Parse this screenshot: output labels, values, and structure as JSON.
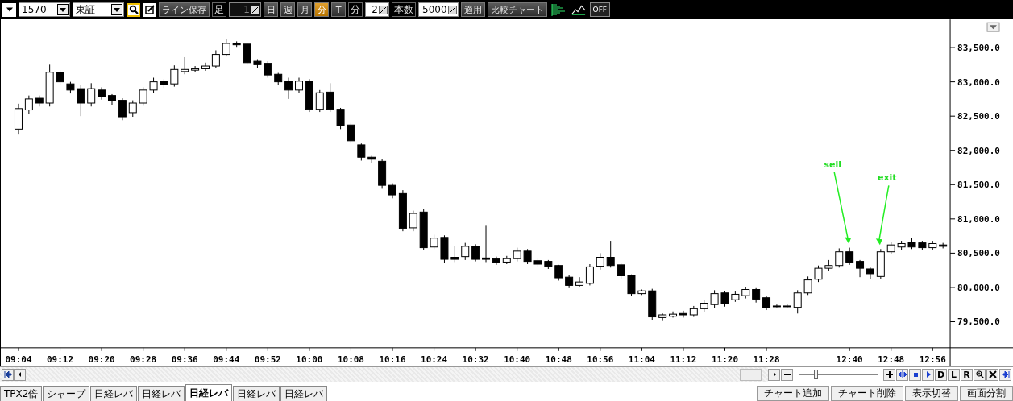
{
  "toolbar": {
    "items": [
      {
        "kind": "menu"
      },
      {
        "kind": "combo",
        "value": "1570"
      },
      {
        "kind": "combo",
        "value": "東証"
      },
      {
        "kind": "tool",
        "selected": true
      },
      {
        "kind": "tool",
        "selected": false
      },
      {
        "kind": "button",
        "label": "ライン保存"
      },
      {
        "kind": "label",
        "text": "足"
      },
      {
        "kind": "spin",
        "value": "1",
        "disabled": true
      },
      {
        "kind": "period",
        "label": "日",
        "selected": false
      },
      {
        "kind": "period",
        "label": "週",
        "selected": false
      },
      {
        "kind": "period",
        "label": "月",
        "selected": false
      },
      {
        "kind": "period",
        "label": "分",
        "selected": true
      },
      {
        "kind": "period",
        "label": "T",
        "selected": false
      },
      {
        "kind": "label",
        "text": "分"
      },
      {
        "kind": "spin",
        "value": "2",
        "disabled": false
      },
      {
        "kind": "label",
        "text": "本数"
      },
      {
        "kind": "spin",
        "value": "5000",
        "disabled": false
      },
      {
        "kind": "button",
        "label": "適用"
      },
      {
        "kind": "button",
        "label": "比較チャート"
      },
      {
        "kind": "tool",
        "selected": false
      },
      {
        "kind": "tool",
        "selected": false
      },
      {
        "kind": "toggle",
        "label": "OFF"
      }
    ]
  },
  "chart": {
    "chart_data": {
      "type": "candlestick",
      "ylim": [
        79120,
        83910
      ],
      "yticks": [
        {
          "value": 83500,
          "label": "83,500.0"
        },
        {
          "value": 83000,
          "label": "83,000.0"
        },
        {
          "value": 82500,
          "label": "82,500.0"
        },
        {
          "value": 82000,
          "label": "82,000.0"
        },
        {
          "value": 81500,
          "label": "81,500.0"
        },
        {
          "value": 81000,
          "label": "81,000.0"
        },
        {
          "value": 80500,
          "label": "80,500.0"
        },
        {
          "value": 80000,
          "label": "80,000.0"
        },
        {
          "value": 79500,
          "label": "79,500.0"
        }
      ],
      "categories": [
        "09:04",
        null,
        null,
        null,
        "09:12",
        null,
        null,
        null,
        "09:20",
        null,
        null,
        null,
        "09:28",
        null,
        null,
        null,
        "09:36",
        null,
        null,
        null,
        "09:44",
        null,
        null,
        null,
        "09:52",
        null,
        null,
        null,
        "10:00",
        null,
        null,
        null,
        "10:08",
        null,
        null,
        null,
        "10:16",
        null,
        null,
        null,
        "10:24",
        null,
        null,
        null,
        "10:32",
        null,
        null,
        null,
        "10:40",
        null,
        null,
        null,
        "10:48",
        null,
        null,
        null,
        "10:56",
        null,
        null,
        null,
        "11:04",
        null,
        null,
        null,
        "11:12",
        null,
        null,
        null,
        "11:20",
        null,
        null,
        null,
        "11:28",
        null,
        null,
        null,
        null,
        null,
        null,
        null,
        "12:40",
        null,
        null,
        null,
        "12:48",
        null,
        null,
        null,
        "12:56",
        null
      ],
      "ohlc": [
        [
          82310,
          82680,
          82230,
          82610
        ],
        [
          82590,
          82800,
          82530,
          82750
        ],
        [
          82760,
          82800,
          82640,
          82690
        ],
        [
          82690,
          83250,
          82640,
          83140
        ],
        [
          83140,
          83170,
          82950,
          83000
        ],
        [
          82970,
          83000,
          82830,
          82880
        ],
        [
          82900,
          82950,
          82500,
          82690
        ],
        [
          82690,
          82980,
          82640,
          82900
        ],
        [
          82880,
          82920,
          82740,
          82780
        ],
        [
          82800,
          82820,
          82660,
          82720
        ],
        [
          82730,
          82760,
          82440,
          82490
        ],
        [
          82550,
          82730,
          82490,
          82690
        ],
        [
          82690,
          82920,
          82650,
          82880
        ],
        [
          82880,
          83060,
          82840,
          83000
        ],
        [
          83010,
          83040,
          82910,
          82960
        ],
        [
          82970,
          83240,
          82930,
          83180
        ],
        [
          83150,
          83360,
          83110,
          83180
        ],
        [
          83170,
          83230,
          83140,
          83190
        ],
        [
          83190,
          83280,
          83160,
          83230
        ],
        [
          83230,
          83460,
          83200,
          83400
        ],
        [
          83400,
          83620,
          83370,
          83560
        ],
        [
          83560,
          83590,
          83510,
          83540
        ],
        [
          83550,
          83570,
          83250,
          83280
        ],
        [
          83300,
          83330,
          83200,
          83250
        ],
        [
          83270,
          83300,
          83060,
          83100
        ],
        [
          83110,
          83130,
          82960,
          83000
        ],
        [
          83010,
          83060,
          82750,
          82880
        ],
        [
          82880,
          83060,
          82840,
          83010
        ],
        [
          83010,
          83040,
          82560,
          82600
        ],
        [
          82600,
          82880,
          82560,
          82840
        ],
        [
          82850,
          82980,
          82560,
          82600
        ],
        [
          82600,
          82620,
          82310,
          82360
        ],
        [
          82370,
          82400,
          82100,
          82140
        ],
        [
          82080,
          82100,
          81850,
          81900
        ],
        [
          81900,
          81920,
          81820,
          81870
        ],
        [
          81840,
          81870,
          81440,
          81490
        ],
        [
          81490,
          81520,
          81300,
          81350
        ],
        [
          81370,
          81420,
          80820,
          80860
        ],
        [
          80870,
          81120,
          80820,
          81080
        ],
        [
          81100,
          81150,
          80540,
          80580
        ],
        [
          80590,
          80770,
          80560,
          80720
        ],
        [
          80730,
          80760,
          80360,
          80410
        ],
        [
          80440,
          80600,
          80370,
          80410
        ],
        [
          80450,
          80650,
          80400,
          80600
        ],
        [
          80600,
          80630,
          80380,
          80410
        ],
        [
          80430,
          80900,
          80370,
          80410
        ],
        [
          80420,
          80450,
          80330,
          80370
        ],
        [
          80370,
          80460,
          80340,
          80420
        ],
        [
          80420,
          80580,
          80380,
          80530
        ],
        [
          80530,
          80560,
          80340,
          80380
        ],
        [
          80390,
          80420,
          80300,
          80340
        ],
        [
          80380,
          80400,
          80270,
          80310
        ],
        [
          80320,
          80330,
          80100,
          80140
        ],
        [
          80150,
          80180,
          79990,
          80030
        ],
        [
          80030,
          80150,
          80000,
          80080
        ],
        [
          80060,
          80340,
          80030,
          80300
        ],
        [
          80310,
          80500,
          80260,
          80440
        ],
        [
          80440,
          80680,
          80290,
          80320
        ],
        [
          80330,
          80350,
          80130,
          80170
        ],
        [
          80170,
          80190,
          79870,
          79910
        ],
        [
          79910,
          79970,
          79890,
          79950
        ],
        [
          79950,
          79980,
          79520,
          79570
        ],
        [
          79560,
          79620,
          79510,
          79600
        ],
        [
          79580,
          79650,
          79560,
          79610
        ],
        [
          79620,
          79660,
          79560,
          79600
        ],
        [
          79600,
          79730,
          79570,
          79690
        ],
        [
          79690,
          79820,
          79640,
          79770
        ],
        [
          79750,
          79960,
          79700,
          79910
        ],
        [
          79920,
          79950,
          79720,
          79760
        ],
        [
          79820,
          79940,
          79790,
          79900
        ],
        [
          79880,
          80000,
          79840,
          79970
        ],
        [
          79970,
          79990,
          79780,
          79830
        ],
        [
          79850,
          79870,
          79670,
          79700
        ],
        [
          79730,
          79750,
          79710,
          79730
        ],
        [
          79730,
          79750,
          79710,
          79730
        ],
        [
          79710,
          79960,
          79620,
          79920
        ],
        [
          79920,
          80160,
          79890,
          80110
        ],
        [
          80120,
          80320,
          80080,
          80280
        ],
        [
          80280,
          80400,
          80240,
          80320
        ],
        [
          80320,
          80570,
          80290,
          80520
        ],
        [
          80520,
          80580,
          80330,
          80370
        ],
        [
          80380,
          80400,
          80150,
          80280
        ],
        [
          80270,
          80290,
          80120,
          80200
        ],
        [
          80160,
          80560,
          80120,
          80520
        ],
        [
          80520,
          80660,
          80490,
          80620
        ],
        [
          80590,
          80680,
          80550,
          80640
        ],
        [
          80660,
          80720,
          80560,
          80590
        ],
        [
          80650,
          80680,
          80540,
          80580
        ],
        [
          80580,
          80680,
          80550,
          80640
        ],
        [
          80620,
          80650,
          80570,
          80600
        ]
      ],
      "annotations": [
        "sell",
        "exit"
      ]
    }
  },
  "nav": {
    "left": [
      {
        "kind": "icon"
      },
      {
        "kind": "icon"
      }
    ],
    "right": [
      {
        "kind": "icon"
      },
      {
        "kind": "icon"
      },
      {
        "kind": "slider",
        "level": 0.2
      },
      {
        "kind": "icon"
      },
      {
        "kind": "icon"
      },
      {
        "kind": "icon"
      },
      {
        "kind": "icon"
      },
      {
        "kind": "text",
        "label": "D"
      },
      {
        "kind": "text",
        "label": "L"
      },
      {
        "kind": "text",
        "label": "R"
      },
      {
        "kind": "icon"
      },
      {
        "kind": "icon"
      },
      {
        "kind": "icon"
      }
    ]
  },
  "tabs": [
    {
      "label": "TPX2倍",
      "selected": false
    },
    {
      "label": "シャープ",
      "selected": false
    },
    {
      "label": "日経レバ",
      "selected": false
    },
    {
      "label": "日経レバ",
      "selected": false
    },
    {
      "label": "日経レバ",
      "selected": true
    },
    {
      "label": "日経レバ",
      "selected": false
    },
    {
      "label": "日経レバ",
      "selected": false
    }
  ],
  "actions": [
    "チャート追加",
    "チャート削除",
    "表示切替",
    "画面分割"
  ]
}
